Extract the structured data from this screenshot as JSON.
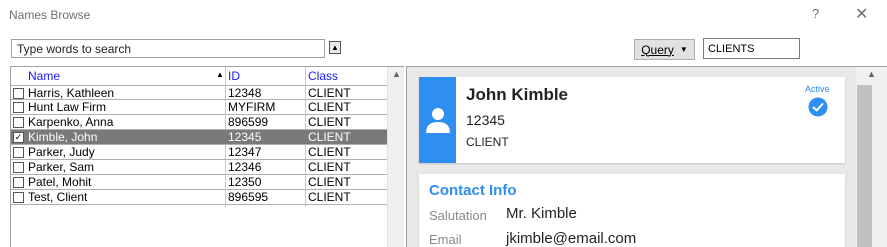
{
  "window": {
    "title": "Names Browse",
    "help_label": "?",
    "close_label": "✕"
  },
  "search": {
    "placeholder": "Type words to search",
    "value": "",
    "collapse_label": "▲"
  },
  "query": {
    "button_label": "Query",
    "class_filter": "CLIENTS"
  },
  "grid": {
    "columns": {
      "name": "Name",
      "id": "ID",
      "class": "Class"
    },
    "sort_indicator": "▲",
    "rows": [
      {
        "name": "Harris, Kathleen",
        "id": "12348",
        "class": "CLIENT",
        "checked": false,
        "selected": false
      },
      {
        "name": "Hunt Law Firm",
        "id": "MYFIRM",
        "class": "CLIENT",
        "checked": false,
        "selected": false
      },
      {
        "name": "Karpenko, Anna",
        "id": "896599",
        "class": "CLIENT",
        "checked": false,
        "selected": false
      },
      {
        "name": "Kimble, John",
        "id": "12345",
        "class": "CLIENT",
        "checked": true,
        "selected": true
      },
      {
        "name": "Parker, Judy",
        "id": "12347",
        "class": "CLIENT",
        "checked": false,
        "selected": false
      },
      {
        "name": "Parker, Sam",
        "id": "12346",
        "class": "CLIENT",
        "checked": false,
        "selected": false
      },
      {
        "name": "Patel, Mohit",
        "id": "12350",
        "class": "CLIENT",
        "checked": false,
        "selected": false
      },
      {
        "name": "Test, Client",
        "id": "896595",
        "class": "CLIENT",
        "checked": false,
        "selected": false
      }
    ]
  },
  "detail": {
    "name": "John Kimble",
    "id": "12345",
    "class": "CLIENT",
    "status": "Active",
    "accent_color": "#2f8ef2",
    "contact": {
      "title": "Contact Info",
      "salutation_label": "Salutation",
      "salutation": "Mr. Kimble",
      "email_label": "Email",
      "email": "jkimble@email.com"
    }
  }
}
